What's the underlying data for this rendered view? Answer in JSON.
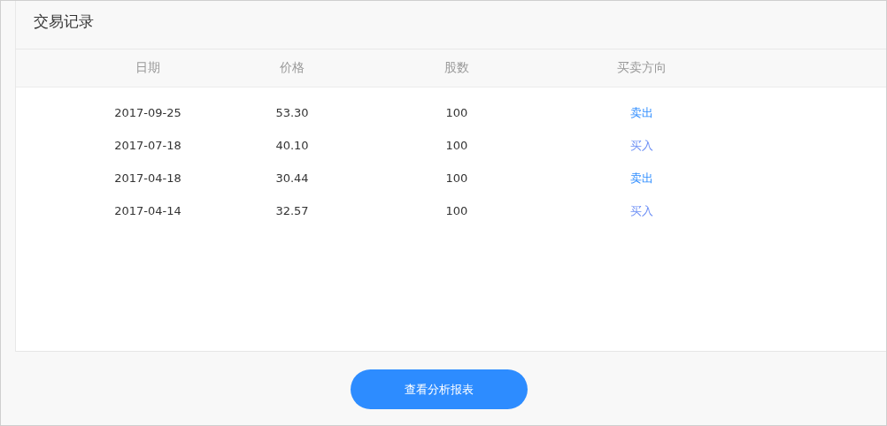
{
  "panel": {
    "title": "交易记录"
  },
  "table": {
    "columns": [
      "日期",
      "价格",
      "股数",
      "买卖方向"
    ],
    "rows": [
      {
        "date": "2017-09-25",
        "price": "53.30",
        "shares": "100",
        "direction": {
          "text": "卖出",
          "kind": "sell"
        }
      },
      {
        "date": "2017-07-18",
        "price": "40.10",
        "shares": "100",
        "direction": {
          "text": "买入",
          "kind": "buy"
        }
      },
      {
        "date": "2017-04-18",
        "price": "30.44",
        "shares": "100",
        "direction": {
          "text": "卖出",
          "kind": "sell"
        }
      },
      {
        "date": "2017-04-14",
        "price": "32.57",
        "shares": "100",
        "direction": {
          "text": "买入",
          "kind": "buy"
        }
      }
    ]
  },
  "button": {
    "label": "查看分析报表"
  }
}
